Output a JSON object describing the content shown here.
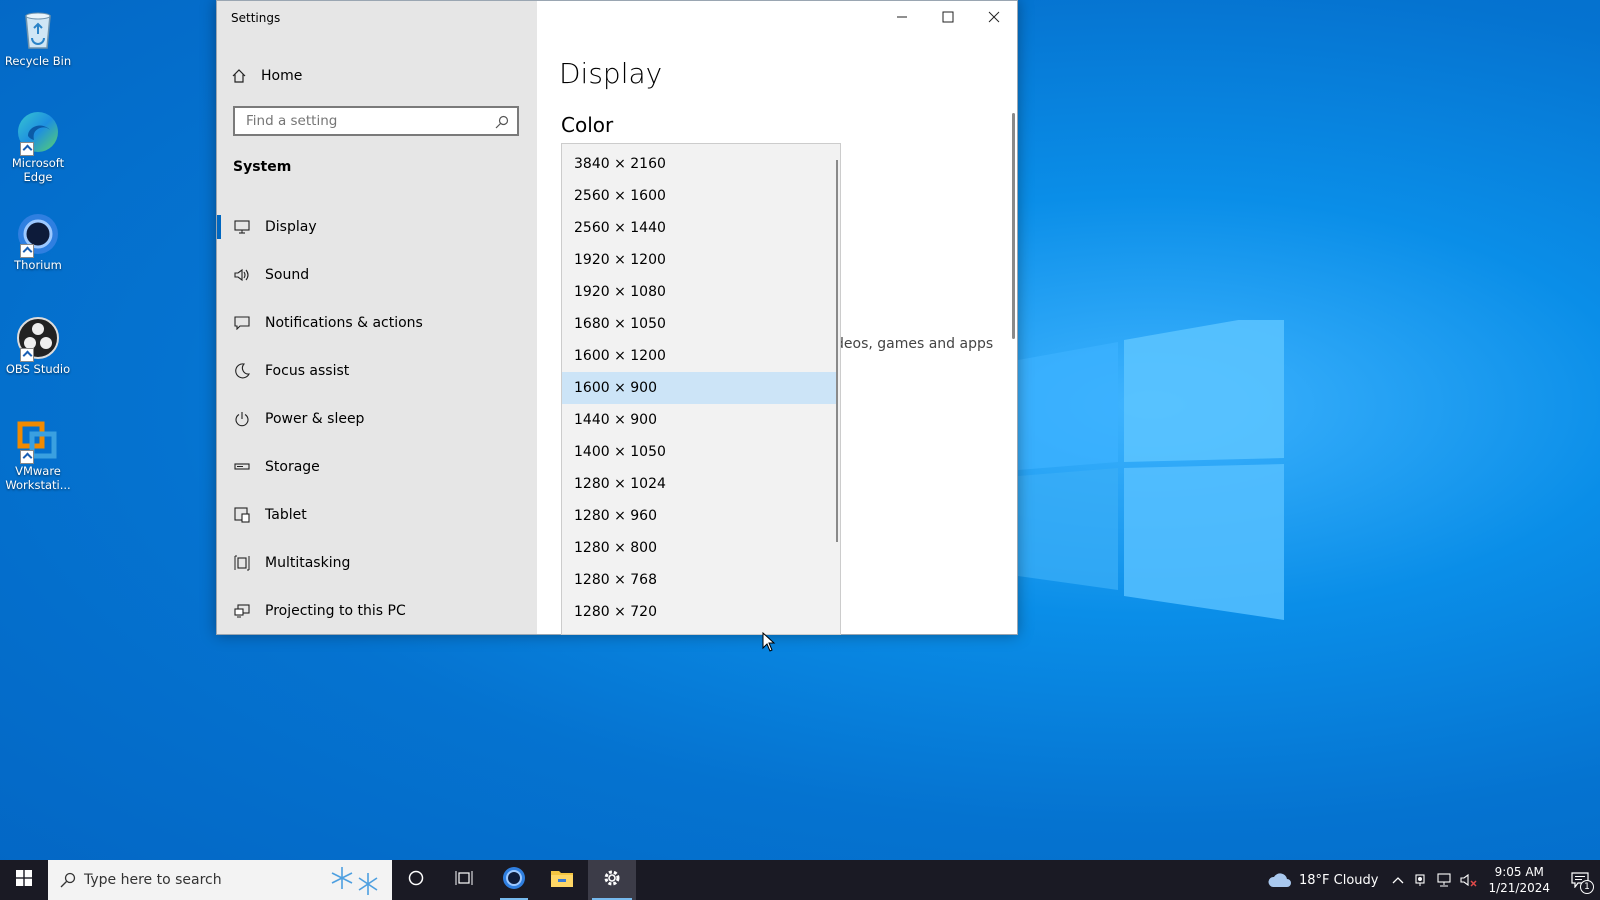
{
  "desktop": {
    "icons": [
      {
        "label": "Recycle Bin"
      },
      {
        "label": "Microsoft Edge"
      },
      {
        "label": "Thorium"
      },
      {
        "label": "OBS Studio"
      },
      {
        "label": "VMware Workstati..."
      }
    ]
  },
  "window": {
    "title": "Settings",
    "home_label": "Home",
    "search_placeholder": "Find a setting",
    "section": "System",
    "nav": [
      {
        "label": "Display",
        "icon": "monitor-icon"
      },
      {
        "label": "Sound",
        "icon": "speaker-icon"
      },
      {
        "label": "Notifications & actions",
        "icon": "notification-icon"
      },
      {
        "label": "Focus assist",
        "icon": "moon-icon"
      },
      {
        "label": "Power & sleep",
        "icon": "power-icon"
      },
      {
        "label": "Storage",
        "icon": "storage-icon"
      },
      {
        "label": "Tablet",
        "icon": "tablet-icon"
      },
      {
        "label": "Multitasking",
        "icon": "multitasking-icon"
      },
      {
        "label": "Projecting to this PC",
        "icon": "projecting-icon"
      }
    ],
    "active_nav": "Display"
  },
  "content": {
    "title": "Display",
    "color_heading": "Color",
    "behind_text": "deos, games and apps",
    "behind_s": "s"
  },
  "resolution_dropdown": {
    "selected": "1600 × 900",
    "options": [
      "3840 × 2160",
      "2560 × 1600",
      "2560 × 1440",
      "1920 × 1200",
      "1920 × 1080",
      "1680 × 1050",
      "1600 × 1200",
      "1600 × 900",
      "1440 × 900",
      "1400 × 1050",
      "1280 × 1024",
      "1280 × 960",
      "1280 × 800",
      "1280 × 768",
      "1280 × 720"
    ]
  },
  "taskbar": {
    "search_placeholder": "Type here to search",
    "weather": "18°F  Cloudy",
    "time": "9:05 AM",
    "date": "1/21/2024",
    "notification_count": "1"
  },
  "colors": {
    "accent": "#0067c0",
    "selection": "#cce4f7",
    "sidebar": "#e6e6e6",
    "taskbar": "#1a1a24"
  }
}
